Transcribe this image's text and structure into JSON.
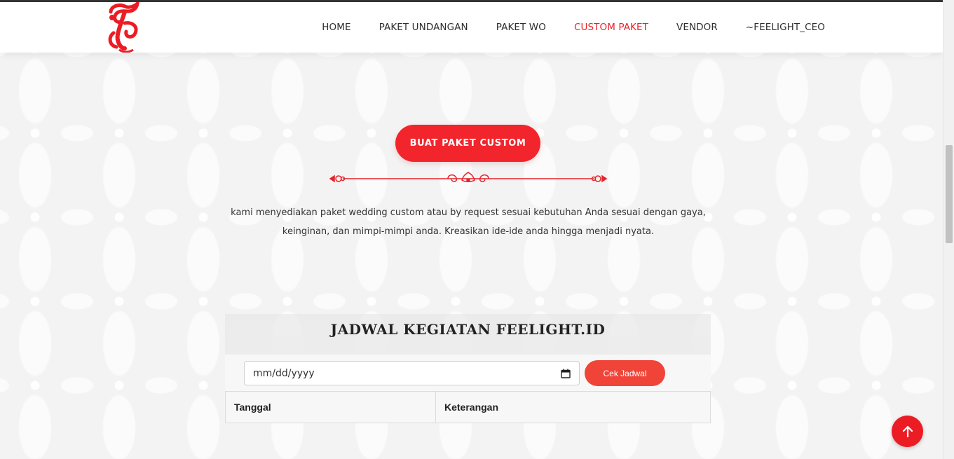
{
  "colors": {
    "accent": "#f2252c",
    "text": "#333333",
    "nav_active": "#e8232a"
  },
  "brand": {
    "logo_icon": "feelight-logo-icon"
  },
  "nav": {
    "items": [
      {
        "label": "HOME",
        "active": false
      },
      {
        "label": "PAKET UNDANGAN",
        "active": false
      },
      {
        "label": "PAKET WO",
        "active": false
      },
      {
        "label": "CUSTOM PAKET",
        "active": true
      },
      {
        "label": "VENDOR",
        "active": false
      },
      {
        "label": "~FEELIGHT_CEO",
        "active": false
      }
    ]
  },
  "hero": {
    "button_label": "BUAT PAKET CUSTOM",
    "divider_icon": "ornament-divider-icon",
    "description_line1": "kami menyediakan paket wedding custom atau by request sesuai kebutuhan Anda sesuai dengan gaya,",
    "description_line2": "keinginan, dan mimpi-mimpi anda. Kreasikan ide-ide anda hingga menjadi nyata."
  },
  "schedule": {
    "title": "JADWAL KEGIATAN FEELIGHT.ID",
    "date_placeholder": "mm/dd/yyyy",
    "check_button": "Cek Jadwal",
    "columns": [
      "Tanggal",
      "Keterangan"
    ]
  },
  "back_to_top_icon": "arrow-up-icon"
}
